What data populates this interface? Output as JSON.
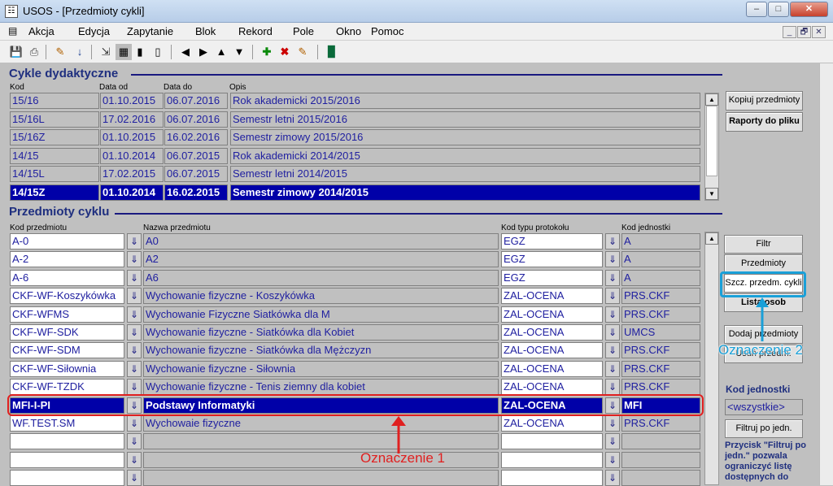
{
  "window": {
    "title": "USOS - [Przedmioty cykli]",
    "icon": "usos-app-icon",
    "controls": [
      "–",
      "□",
      "✕"
    ]
  },
  "menu": [
    "Akcja",
    "Edycja",
    "Zapytanie",
    "Blok",
    "Rekord",
    "Pole",
    "Okno",
    "Pomoc"
  ],
  "mdi_controls": [
    "_",
    "🗗",
    "✕"
  ],
  "cykle": {
    "title": "Cykle dydaktyczne",
    "headers": [
      "Kod",
      "Data od",
      "Data do",
      "Opis"
    ],
    "rows": [
      [
        "15/16",
        "01.10.2015",
        "06.07.2016",
        "Rok akademicki 2015/2016"
      ],
      [
        "15/16L",
        "17.02.2016",
        "06.07.2016",
        "Semestr letni 2015/2016"
      ],
      [
        "15/16Z",
        "01.10.2015",
        "16.02.2016",
        "Semestr zimowy 2015/2016"
      ],
      [
        "14/15",
        "01.10.2014",
        "06.07.2015",
        "Rok akademicki 2014/2015"
      ],
      [
        "14/15L",
        "17.02.2015",
        "06.07.2015",
        "Semestr letni 2014/2015"
      ],
      [
        "14/15Z",
        "01.10.2014",
        "16.02.2015",
        "Semestr zimowy 2014/2015"
      ]
    ],
    "selected": 5,
    "buttons": [
      "Kopiuj przedmioty",
      "Raporty do pliku"
    ]
  },
  "przedmioty": {
    "title": "Przedmioty cyklu",
    "headers": [
      "Kod przedmiotu",
      "Nazwa przedmiotu",
      "Kod typu protokołu",
      "Kod jednostki"
    ],
    "rows": [
      [
        "A-0",
        "A0",
        "EGZ",
        "A"
      ],
      [
        "A-2",
        "A2",
        "EGZ",
        "A"
      ],
      [
        "A-6",
        "A6",
        "EGZ",
        "A"
      ],
      [
        "CKF-WF-Koszykówka",
        "Wychowanie fizyczne - Koszykówka",
        "ZAL-OCENA",
        "PRS.CKF"
      ],
      [
        "CKF-WFMS",
        "Wychowanie Fizyczne Siatkówka dla M",
        "ZAL-OCENA",
        "PRS.CKF"
      ],
      [
        "CKF-WF-SDK",
        "Wychowanie fizyczne - Siatkówka dla Kobiet",
        "ZAL-OCENA",
        "UMCS"
      ],
      [
        "CKF-WF-SDM",
        "Wychowanie fizyczne - Siatkówka dla Mężczyzn",
        "ZAL-OCENA",
        "PRS.CKF"
      ],
      [
        "CKF-WF-Siłownia",
        "Wychowanie fizyczne - Siłownia",
        "ZAL-OCENA",
        "PRS.CKF"
      ],
      [
        "CKF-WF-TZDK",
        "Wychowanie fizyczne - Tenis ziemny dla kobiet",
        "ZAL-OCENA",
        "PRS.CKF"
      ],
      [
        "MFI-I-PI",
        "Podstawy Informatyki",
        "ZAL-OCENA",
        "MFI"
      ],
      [
        "WF.TEST.SM",
        "Wychowaie fizyczne",
        "ZAL-OCENA",
        "PRS.CKF"
      ],
      [
        "",
        "",
        "",
        ""
      ],
      [
        "",
        "",
        "",
        ""
      ],
      [
        "",
        "",
        "",
        ""
      ]
    ],
    "selected": 9,
    "buttons": [
      "Filtr",
      "Przedmioty",
      "Szcz. przedm. cykli",
      "Lista osob",
      "Dodaj przedmioty",
      "Usuń przedm."
    ],
    "kod_jednostki_label": "Kod jednostki",
    "kod_jednostki_value": "<wszystkie>",
    "filtruj": "Filtruj po jedn.",
    "hint": "Przycisk \"Filtruj po jedn.\" pozwala ograniczyć listę dostępnych do"
  },
  "annotations": {
    "a1": "Oznaczenie 1",
    "a2": "Oznaczenie 2",
    "colors": {
      "a1": "#e02020",
      "a2": "#1aa0d8"
    }
  }
}
